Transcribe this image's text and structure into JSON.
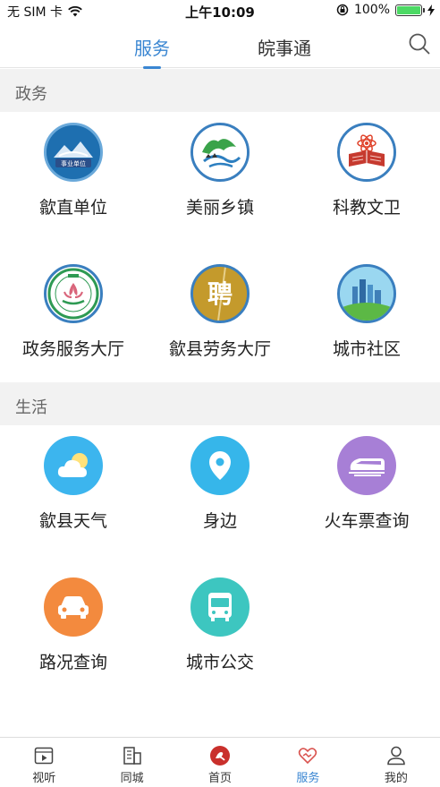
{
  "status_bar": {
    "carrier": "无 SIM 卡",
    "time": "上午10:09",
    "battery": "100%",
    "battery_level": 1.0
  },
  "topbar": {
    "tabs": [
      {
        "label": "服务",
        "active": true
      },
      {
        "label": "皖事通",
        "active": false
      }
    ],
    "search_icon": "search-icon"
  },
  "sections": [
    {
      "title": "政务",
      "items": [
        {
          "label": "歙直单位",
          "icon": "public-institution-icon"
        },
        {
          "label": "美丽乡镇",
          "icon": "landscape-icon"
        },
        {
          "label": "科教文卫",
          "icon": "science-education-icon"
        },
        {
          "label": "政务服务大厅",
          "icon": "gov-service-hall-icon"
        },
        {
          "label": "歙县劳务大厅",
          "icon": "recruit-icon"
        },
        {
          "label": "城市社区",
          "icon": "city-community-icon"
        }
      ]
    },
    {
      "title": "生活",
      "items": [
        {
          "label": "歙县天气",
          "icon": "weather-icon"
        },
        {
          "label": "身边",
          "icon": "location-pin-icon"
        },
        {
          "label": "火车票查询",
          "icon": "train-icon"
        },
        {
          "label": "路况查询",
          "icon": "car-icon"
        },
        {
          "label": "城市公交",
          "icon": "bus-icon"
        }
      ]
    }
  ],
  "icon_texts": {
    "public_institution": "事业单位",
    "recruit": "聘"
  },
  "bottom_nav": [
    {
      "label": "视听",
      "icon": "video-icon",
      "active": false
    },
    {
      "label": "同城",
      "icon": "building-icon",
      "active": false
    },
    {
      "label": "首页",
      "icon": "home-logo-icon",
      "active": false
    },
    {
      "label": "服务",
      "icon": "heart-hands-icon",
      "active": true
    },
    {
      "label": "我的",
      "icon": "profile-icon",
      "active": false
    }
  ],
  "colors": {
    "accent": "#3a86d2",
    "weather": "#3cb5ee",
    "location": "#36b6ea",
    "train": "#a77fd6",
    "car": "#f38a3e",
    "bus": "#3dc6c0"
  }
}
